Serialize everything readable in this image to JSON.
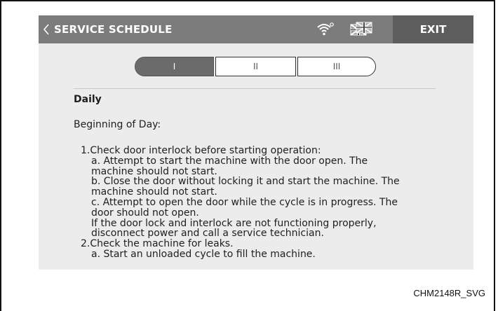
{
  "header": {
    "back_icon": "chevron-left-icon",
    "title": "SERVICE SCHEDULE",
    "wifi_icon": "wifi-icon",
    "language_icon": "language-flag-icon",
    "exit_label": "EXIT"
  },
  "tabs": [
    {
      "label": "I",
      "selected": true
    },
    {
      "label": "II",
      "selected": false
    },
    {
      "label": "III",
      "selected": false
    }
  ],
  "content": {
    "heading": "Daily",
    "subheading": "Beginning of Day:",
    "lines": [
      "1.Check door interlock before starting operation:",
      "a. Attempt to start the machine with the door open. The",
      "machine should not start.",
      "b. Close the door without locking it and start the machine. The",
      "machine should not start.",
      "c. Attempt to open the door while the cycle is in progress. The",
      "door should not open.",
      "If the door lock and interlock are not functioning properly,",
      "disconnect power and call a service technician.",
      "2.Check the machine for leaks.",
      "a. Start an unloaded cycle to fill the machine."
    ]
  },
  "figure_id": "CHM2148R_SVG",
  "colors": {
    "header_bar": "#7c7c7c",
    "exit_button": "#5d5d5d",
    "screen_bg": "#ececec",
    "selected_tab": "#6b6b6b"
  }
}
